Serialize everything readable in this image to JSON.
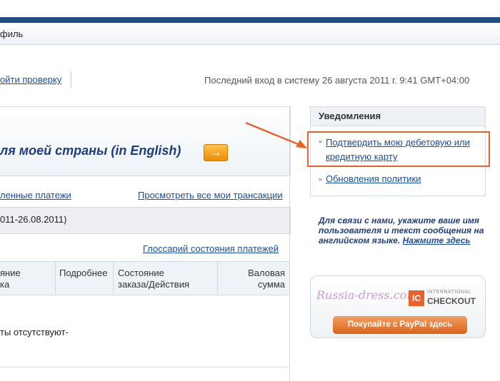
{
  "nav": {
    "profile_tab": "филь"
  },
  "account": {
    "verify_link": "ойти проверку",
    "last_login": "Последний вход в систему 26 августа 2011 г. 9:41 GMT+04:00"
  },
  "banner": {
    "text": "ля моей страны (in English)",
    "button_icon": "→"
  },
  "links": {
    "payments": "ленные платежи",
    "all_transactions": "Просмотреть все мои трансакции"
  },
  "period": {
    "text": "011-26.08.2011)"
  },
  "glossary": {
    "link": "Глоссарий состояния платежей"
  },
  "table": {
    "col1_line1": "яние",
    "col1_line2": "ка",
    "col2": "Подробнее",
    "col3_line1": "Состояние",
    "col3_line2": "заказа/Действия",
    "col4_line1": "Валовая",
    "col4_line2": "сумма",
    "empty_text": "ты отсутствуют-"
  },
  "notifications": {
    "title": "Уведомления",
    "items": [
      "Подтвердить мою дебетовую или кредитную карту",
      "Обновления политики"
    ]
  },
  "contact": {
    "text": "Для связи с нами, укажите ваше имя пользователя и текст сообщения на английском языке.",
    "link": "Нажмите здесь"
  },
  "promo": {
    "brand": "Russia-dress.com",
    "ic_logo": "IC",
    "ic_small": "INTERNATIONAL",
    "ic_big": "CHECKOUT",
    "button": "Покупайте с PayPal здесь"
  },
  "colors": {
    "accent": "#1f4f84",
    "link": "#1a4f9c",
    "highlight": "#e8632b"
  }
}
